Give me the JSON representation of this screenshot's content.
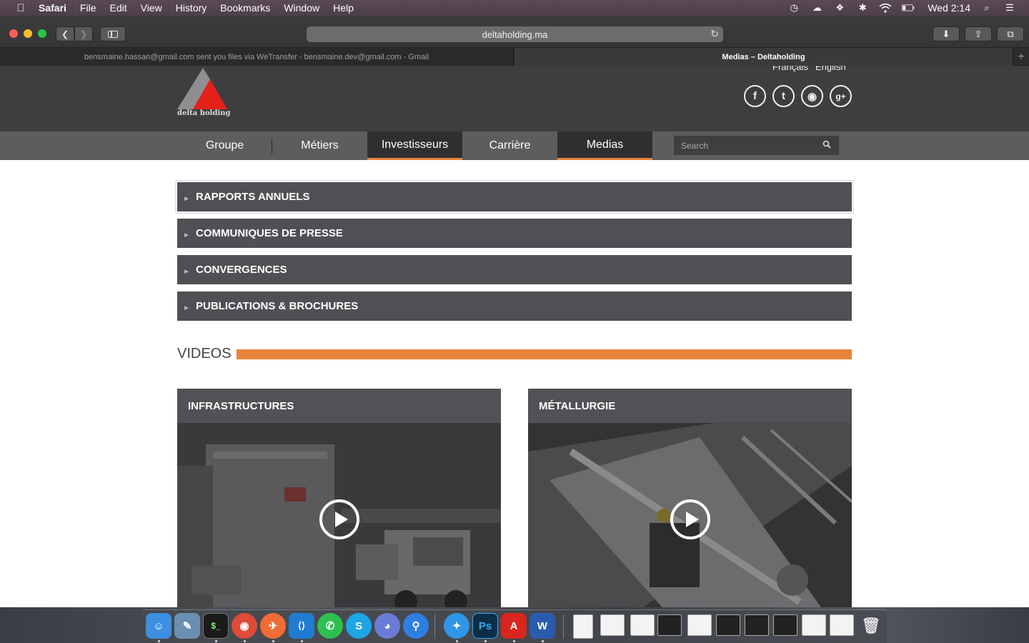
{
  "menubar": {
    "apple": "",
    "items": [
      "Safari",
      "File",
      "Edit",
      "View",
      "History",
      "Bookmarks",
      "Window",
      "Help"
    ],
    "clock": "Wed 2:14"
  },
  "browser": {
    "url": "deltaholding.ma",
    "tabs": [
      "bensmaine.hassan@gmail.com sent you files via WeTransfer - bensmaine.dev@gmail.com - Gmail",
      "Medias – Deltaholding"
    ],
    "new_tab": "+"
  },
  "site": {
    "logo_text": "delta holding",
    "logo_colors": {
      "grey": "#8f8f92",
      "red": "#e32119"
    },
    "languages": [
      "Français",
      "English"
    ],
    "social": [
      {
        "icon": "facebook-icon",
        "glyph": "f"
      },
      {
        "icon": "twitter-icon",
        "glyph": "t"
      },
      {
        "icon": "rss-icon",
        "glyph": "◉"
      },
      {
        "icon": "google-plus-icon",
        "glyph": "g+"
      }
    ],
    "nav": [
      "Groupe",
      "Métiers",
      "Investisseurs",
      "Carrière",
      "Medias"
    ],
    "search_placeholder": "Search",
    "accent": "#e8843a"
  },
  "media": {
    "sections": [
      "RAPPORTS ANNUELS",
      "COMMUNIQUES DE PRESSE",
      "CONVERGENCES",
      "PUBLICATIONS & BROCHURES"
    ],
    "videos_title": "VIDEOS",
    "videos": [
      {
        "title": "INFRASTRUCTURES"
      },
      {
        "title": "MÉTALLURGIE"
      }
    ]
  },
  "dock": {
    "apps": [
      {
        "name": "finder-icon",
        "label": "☺",
        "color": "#3d8fe0"
      },
      {
        "name": "preview-icon",
        "label": "✎",
        "color": "#6a8fb0"
      },
      {
        "name": "terminal-icon",
        "label": "$_",
        "color": "#1b1b1b"
      },
      {
        "name": "chrome-icon",
        "label": "◉",
        "color": "#dd4b39"
      },
      {
        "name": "postman-icon",
        "label": "✈",
        "color": "#ef6c35"
      },
      {
        "name": "vscode-icon",
        "label": "⟨⟩",
        "color": "#1f7cd0"
      },
      {
        "name": "whatsapp-icon",
        "label": "✆",
        "color": "#2fbf4f"
      },
      {
        "name": "skype-icon",
        "label": "S",
        "color": "#1ea5e6"
      },
      {
        "name": "discord-icon",
        "label": "◕",
        "color": "#6b7cd8"
      },
      {
        "name": "maps-pin-icon",
        "label": "⚲",
        "color": "#2f7fe3"
      },
      {
        "name": "safari-icon",
        "label": "✦",
        "color": "#2f95e8"
      },
      {
        "name": "photoshop-icon",
        "label": "Ps",
        "color": "#0b2f47"
      },
      {
        "name": "acrobat-icon",
        "label": "A",
        "color": "#d8251d"
      },
      {
        "name": "word-icon",
        "label": "W",
        "color": "#2a5cae"
      }
    ]
  }
}
